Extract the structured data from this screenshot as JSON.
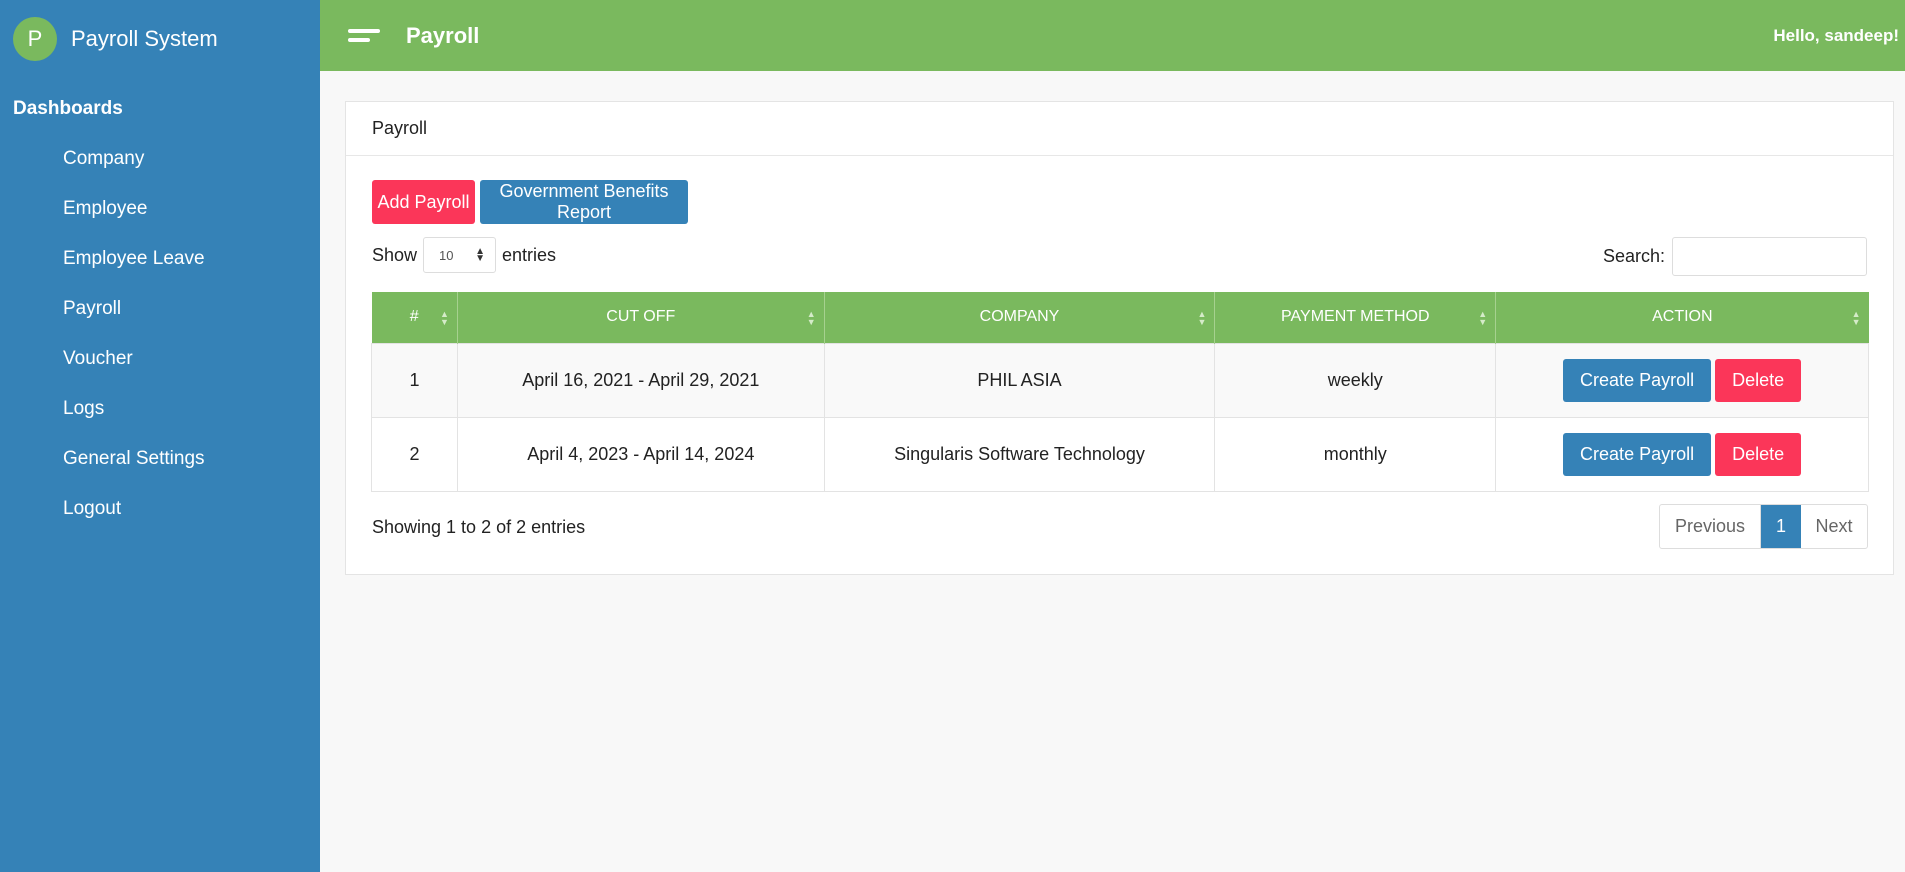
{
  "sidebar": {
    "logo_letter": "P",
    "brand": "Payroll System",
    "section_title": "Dashboards",
    "items": [
      {
        "label": "Company"
      },
      {
        "label": "Employee"
      },
      {
        "label": "Employee Leave"
      },
      {
        "label": "Payroll"
      },
      {
        "label": "Voucher"
      },
      {
        "label": "Logs"
      },
      {
        "label": "General Settings"
      },
      {
        "label": "Logout"
      }
    ]
  },
  "topbar": {
    "title": "Payroll",
    "greeting": "Hello, sandeep!"
  },
  "card": {
    "header": "Payroll",
    "add_button": "Add Payroll",
    "report_button": "Government Benefits Report",
    "show_label": "Show",
    "entries_value": "10",
    "entries_label": "entries",
    "search_label": "Search:",
    "search_value": ""
  },
  "table": {
    "columns": [
      "#",
      "CUT OFF",
      "COMPANY",
      "PAYMENT METHOD",
      "ACTION"
    ],
    "rows": [
      {
        "num": "1",
        "cutoff": "April 16, 2021 - April 29, 2021",
        "company": "PHIL ASIA",
        "method": "weekly",
        "create": "Create Payroll",
        "delete": "Delete"
      },
      {
        "num": "2",
        "cutoff": "April 4, 2023 - April 14, 2024",
        "company": "Singularis Software Technology",
        "method": "monthly",
        "create": "Create Payroll",
        "delete": "Delete"
      }
    ]
  },
  "footer": {
    "info": "Showing 1 to 2 of 2 entries",
    "previous": "Previous",
    "page": "1",
    "next": "Next"
  },
  "colors": {
    "sidebar": "#3582b7",
    "topbar": "#7ab95e",
    "danger": "#fb3659",
    "primary": "#3582b7"
  }
}
